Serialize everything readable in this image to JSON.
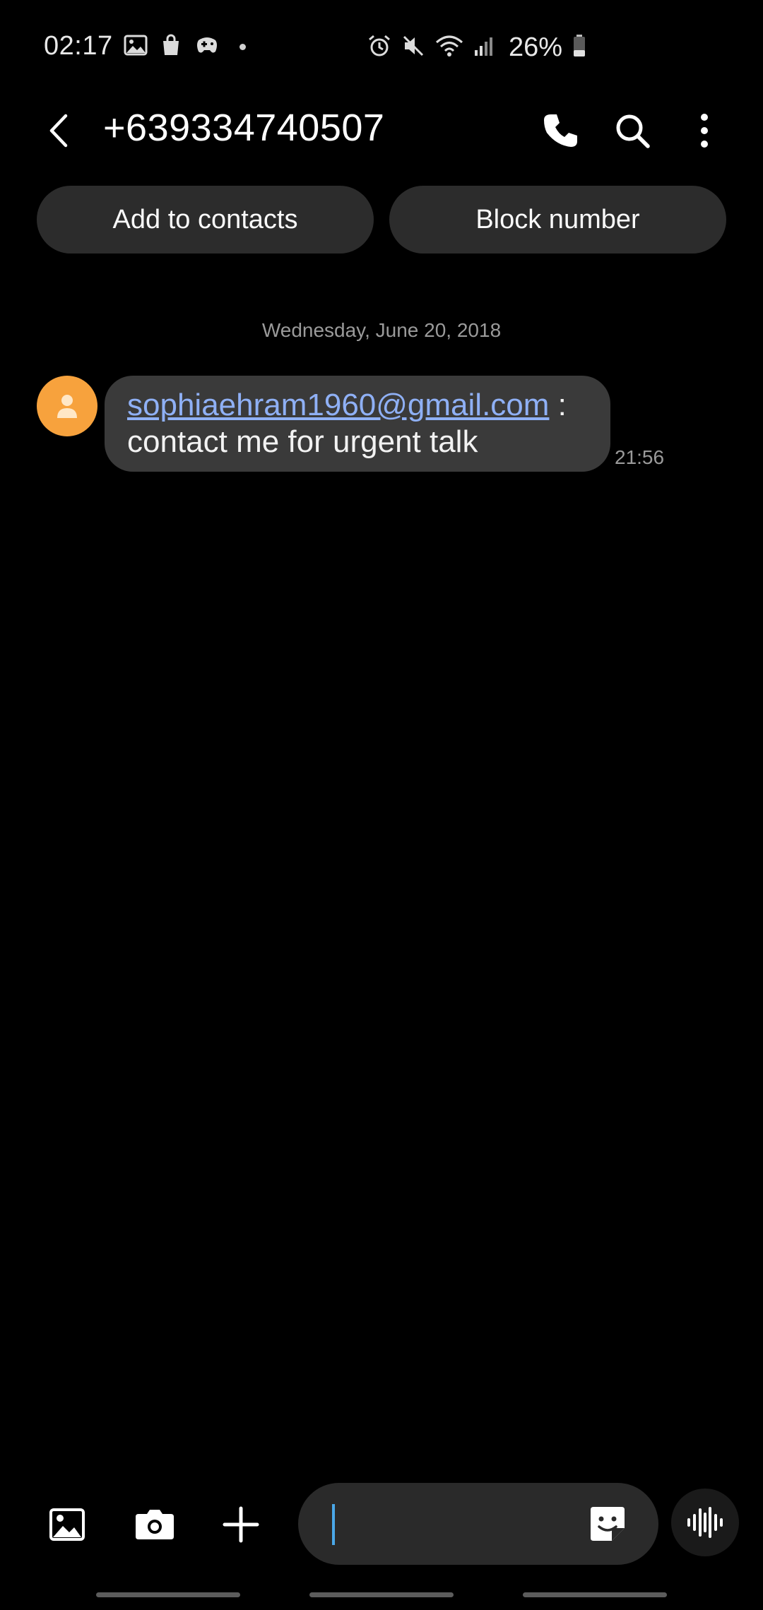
{
  "status_bar": {
    "time": "02:17",
    "battery": "26%",
    "left_icons": [
      "gallery-icon",
      "shopping-bag-icon",
      "game-controller-icon"
    ],
    "right_icons": [
      "alarm-icon",
      "mute-icon",
      "wifi-icon",
      "signal-icon",
      "battery-icon"
    ]
  },
  "app_bar": {
    "title": "+639334740507",
    "actions": [
      "phone-icon",
      "search-icon",
      "more-vertical-icon"
    ]
  },
  "actions": {
    "add_contact": "Add to contacts",
    "block": "Block number"
  },
  "conversation": {
    "date": "Wednesday, June 20, 2018",
    "messages": [
      {
        "link_text": "sophiaehram1960@gmail.com",
        "separator": " :",
        "body": "contact me for urgent talk",
        "time": "21:56"
      }
    ]
  },
  "composer": {
    "placeholder": "",
    "icons": [
      "gallery-icon",
      "camera-icon",
      "plus-icon",
      "sticker-icon",
      "voice-icon"
    ]
  },
  "colors": {
    "background": "#000000",
    "bubble": "#3a3a3a",
    "pill": "#2c2c2c",
    "avatar": "#f7a23d",
    "link": "#8fb0f5",
    "caret": "#4aa8e8"
  }
}
